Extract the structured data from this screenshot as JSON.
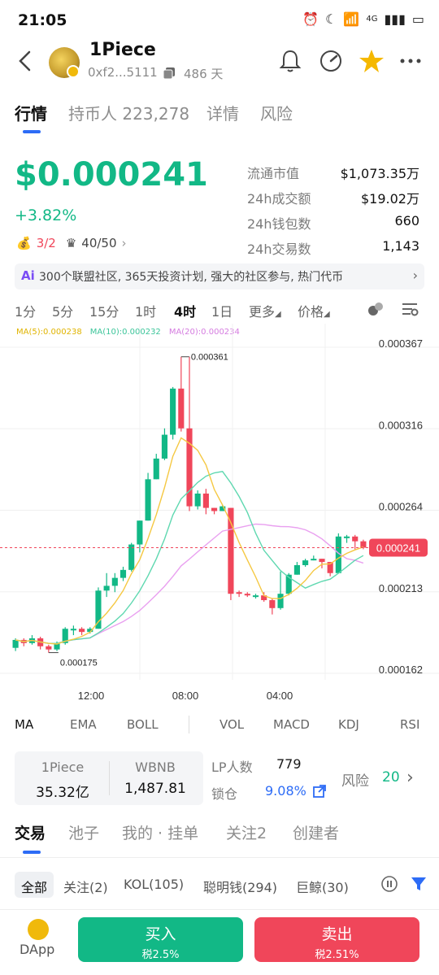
{
  "status_bar": {
    "time": "21:05",
    "network": "4G"
  },
  "header": {
    "token_name": "1Piece",
    "address": "0xf2...5111",
    "age": "486 天"
  },
  "tabs": [
    "行情",
    "持币人 223,278",
    "详情",
    "风险"
  ],
  "price": {
    "value": "$0.000241",
    "change": "+3.82%",
    "badge_a": "3/2",
    "badge_b": "40/50"
  },
  "stats": [
    {
      "label": "流通市值",
      "value": "$1,073.35万"
    },
    {
      "label": "24h成交额",
      "value": "$19.02万"
    },
    {
      "label": "24h钱包数",
      "value": "660"
    },
    {
      "label": "24h交易数",
      "value": "1,143"
    }
  ],
  "ai_banner": {
    "tag": "Ai",
    "text": "300个联盟社区, 365天投资计划, 强大的社区参与, 热门代币"
  },
  "timeframes": [
    "1分",
    "5分",
    "15分",
    "1时",
    "4时",
    "1日",
    "更多",
    "价格"
  ],
  "ma_legend": {
    "ma5": "MA(5):0.000238",
    "ma10": "MA(10):0.000232",
    "ma20": "MA(20):0.000234"
  },
  "colors": {
    "up": "#12b886",
    "down": "#f0465a",
    "accent": "#2d6cf6",
    "ma5": "#f5c842",
    "ma10": "#5fd8b0",
    "ma20": "#e9a0f0"
  },
  "chart_data": {
    "type": "candlestick",
    "y_ticks": [
      "0.000367",
      "0.000316",
      "0.000264",
      "0.000213",
      "0.000162"
    ],
    "ylim": [
      0.000162,
      0.000367
    ],
    "x_ticks": [
      "12:00",
      "08:00",
      "04:00"
    ],
    "high_label": "0.000361",
    "low_label": "0.000175",
    "current_price_label": "0.000241",
    "candles": [
      [
        0.000178,
        0.000183,
        0.000176,
        0.000184
      ],
      [
        0.000183,
        0.000181,
        0.000179,
        0.000184
      ],
      [
        0.000181,
        0.000184,
        0.00018,
        0.000186
      ],
      [
        0.000184,
        0.000179,
        0.000177,
        0.000185
      ],
      [
        0.000179,
        0.000177,
        0.000175,
        0.00018
      ],
      [
        0.000177,
        0.000181,
        0.000176,
        0.000182
      ],
      [
        0.000181,
        0.00019,
        0.00018,
        0.000191
      ],
      [
        0.00019,
        0.00019,
        0.000186,
        0.000192
      ],
      [
        0.00019,
        0.000188,
        0.000186,
        0.000191
      ],
      [
        0.000188,
        0.00019,
        0.000187,
        0.000191
      ],
      [
        0.00019,
        0.000214,
        0.00019,
        0.000216
      ],
      [
        0.000214,
        0.000217,
        0.00021,
        0.000225
      ],
      [
        0.000217,
        0.000222,
        0.000213,
        0.000225
      ],
      [
        0.000222,
        0.000227,
        0.00022,
        0.000229
      ],
      [
        0.000227,
        0.000243,
        0.000226,
        0.000244
      ],
      [
        0.000243,
        0.000258,
        0.000238,
        0.000258
      ],
      [
        0.000258,
        0.000284,
        0.000258,
        0.000288
      ],
      [
        0.000284,
        0.000297,
        0.000284,
        0.0003
      ],
      [
        0.000297,
        0.000312,
        0.000296,
        0.000316
      ],
      [
        0.000312,
        0.000341,
        0.000309,
        0.000342
      ],
      [
        0.000341,
        0.000316,
        0.000314,
        0.000361
      ],
      [
        0.000316,
        0.000267,
        0.000264,
        0.000361
      ],
      [
        0.000267,
        0.000275,
        0.000265,
        0.000277
      ],
      [
        0.000275,
        0.000266,
        0.000262,
        0.000278
      ],
      [
        0.000266,
        0.000264,
        0.000262,
        0.000266
      ],
      [
        0.000264,
        0.000267,
        0.000264,
        0.000268
      ],
      [
        0.000266,
        0.000212,
        0.000208,
        0.000266
      ],
      [
        0.000213,
        0.000212,
        0.00021,
        0.000214
      ],
      [
        0.000212,
        0.000211,
        0.00021,
        0.000213
      ],
      [
        0.000211,
        0.000211,
        0.000209,
        0.000212
      ],
      [
        0.000211,
        0.000208,
        0.000207,
        0.000213
      ],
      [
        0.000208,
        0.000203,
        0.000199,
        0.000209
      ],
      [
        0.000203,
        0.000212,
        0.000202,
        0.000226
      ],
      [
        0.000212,
        0.000224,
        0.000211,
        0.000225
      ],
      [
        0.000224,
        0.00023,
        0.000224,
        0.000232
      ],
      [
        0.00023,
        0.000233,
        0.000229,
        0.000234
      ],
      [
        0.000233,
        0.000234,
        0.000233,
        0.000236
      ],
      [
        0.000234,
        0.000232,
        0.000228,
        0.000234
      ],
      [
        0.000232,
        0.000225,
        0.000223,
        0.000232
      ],
      [
        0.000225,
        0.000248,
        0.000225,
        0.00025
      ],
      [
        0.000248,
        0.000248,
        0.000244,
        0.000249
      ],
      [
        0.000248,
        0.000245,
        0.00024,
        0.000249
      ],
      [
        0.000245,
        0.000241,
        0.00024,
        0.000246
      ]
    ]
  },
  "indicators": [
    "MA",
    "EMA",
    "BOLL",
    "VOL",
    "MACD",
    "KDJ",
    "RSI"
  ],
  "pool": {
    "token_a": "1Piece",
    "token_a_amount": "35.32亿",
    "token_b": "WBNB",
    "token_b_amount": "1,487.81",
    "lp_label": "LP人数",
    "lp_value": "779",
    "lock_label": "锁仓",
    "lock_value": "9.08%",
    "risk_label": "风险",
    "risk_value": "20"
  },
  "bottom_tabs": [
    "交易",
    "池子",
    "我的 · 挂单",
    "关注2",
    "创建者"
  ],
  "chips": [
    "全部",
    "关注(2)",
    "KOL(105)",
    "聪明钱(294)",
    "巨鲸(30)"
  ],
  "action": {
    "dapp": "DApp",
    "buy": "买入",
    "buy_tax": "税2.5%",
    "sell": "卖出",
    "sell_tax": "税2.51%"
  }
}
